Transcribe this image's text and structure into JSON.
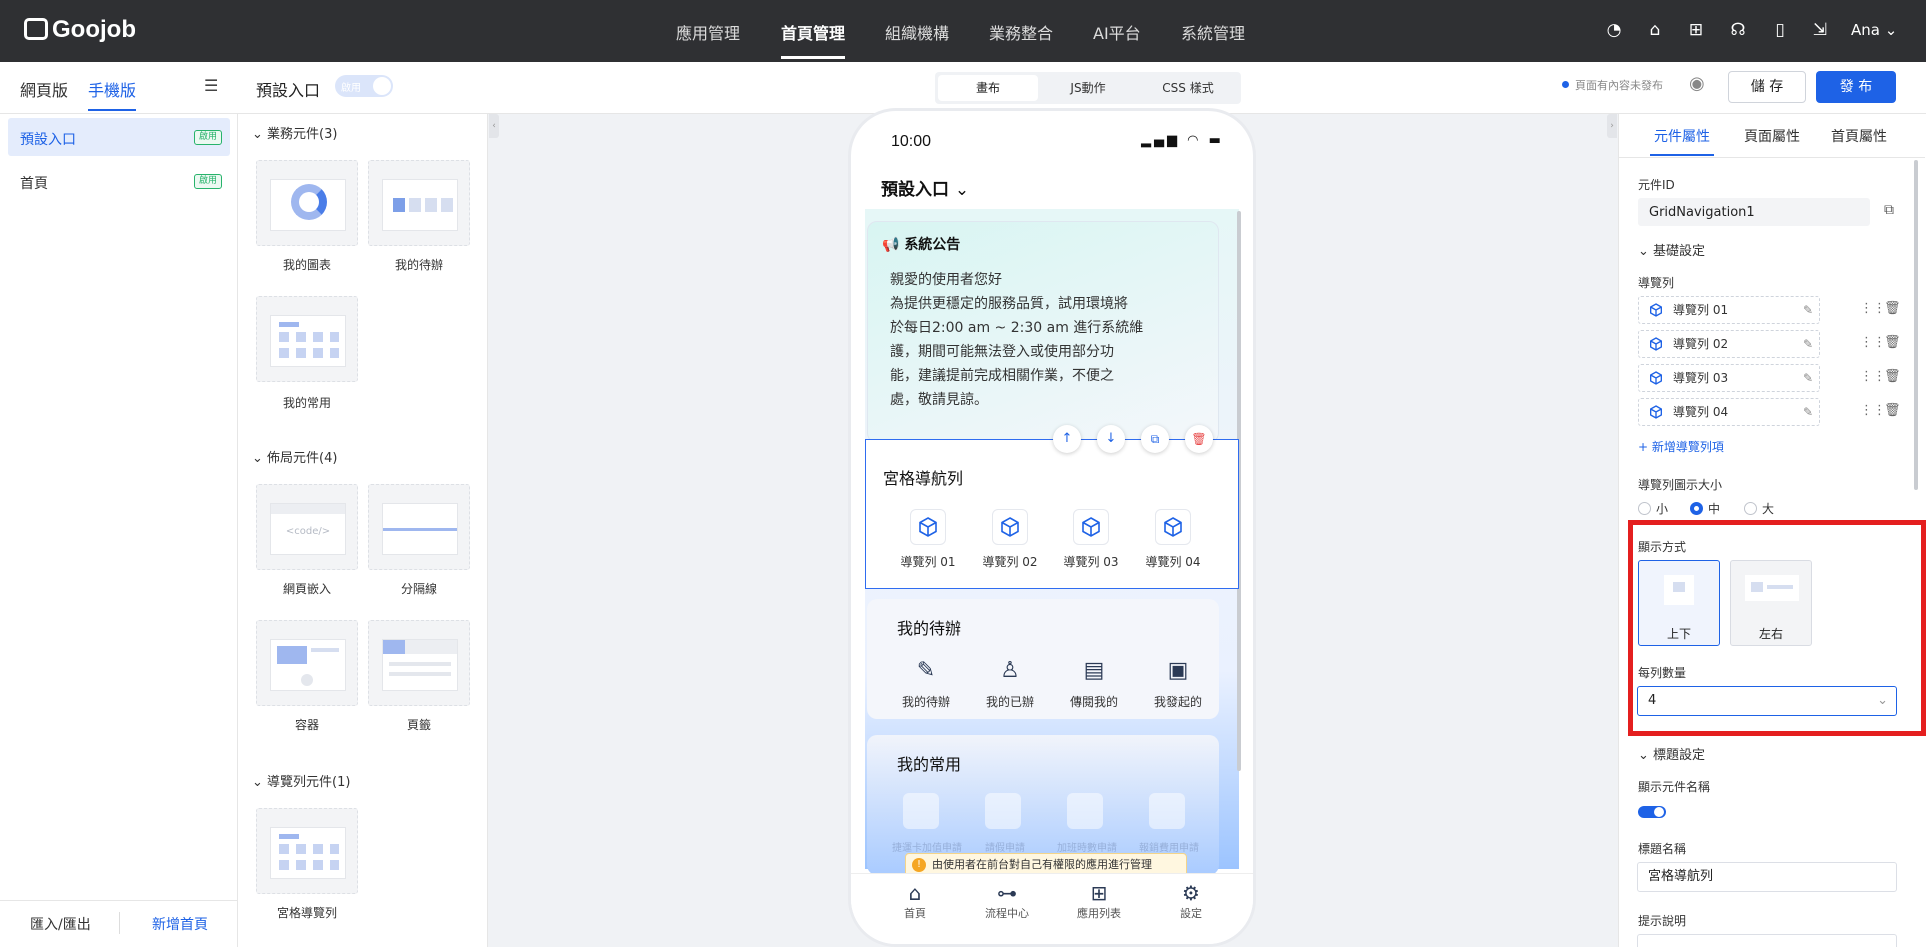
{
  "topbar": {
    "logo": "Goojob",
    "nav": [
      "應用管理",
      "首頁管理",
      "組織機構",
      "業務整合",
      "AI平台",
      "系統管理"
    ],
    "active_index": 1,
    "user": "Ana"
  },
  "secbar": {
    "tab_web": "網頁版",
    "tab_mobile": "手機版",
    "page_title": "預設入口",
    "toggle_label": "啟用",
    "views": [
      "畫布",
      "JS動作",
      "CSS 樣式"
    ],
    "status": "頁面有內容未發布",
    "save": "儲 存",
    "publish": "發 布"
  },
  "leftnav": {
    "items": [
      {
        "label": "預設入口",
        "badge": "啟用"
      },
      {
        "label": "首頁",
        "badge": "啟用"
      }
    ],
    "import_export": "匯入/匯出",
    "add_home": "新增首頁"
  },
  "components": {
    "business_title": "業務元件(3)",
    "business": [
      "我的圖表",
      "我的待辦",
      "我的常用"
    ],
    "layout_title": "佈局元件(4)",
    "layout": [
      "網頁嵌入",
      "分隔線",
      "容器",
      "頁籤"
    ],
    "layout_code": "<code/>",
    "nav_title": "導覽列元件(1)",
    "nav": [
      "宮格導覽列"
    ]
  },
  "phone": {
    "time": "10:00",
    "entry": "預設入口",
    "notice_title": "系統公告",
    "notice_lines": [
      "親愛的使用者您好",
      "為提供更穩定的服務品質，試用環境將",
      "於每日2:00 am ~ 2:30 am 進行系統維",
      "護，期間可能無法登入或使用部分功",
      "能，建議提前完成相關作業，不便之",
      "處，敬請見諒。"
    ],
    "grid_title": "宮格導航列",
    "grid_items": [
      "導覽列 01",
      "導覽列 02",
      "導覽列 03",
      "導覽列 04"
    ],
    "todo_title": "我的待辦",
    "todo_items": [
      "我的待辦",
      "我的已辦",
      "傳閱我的",
      "我發起的"
    ],
    "common_title": "我的常用",
    "common_faded": [
      "捷運卡加值申請",
      "請假申請",
      "加班時數申請",
      "報銷費用申請"
    ],
    "warning": "由使用者在前台對自己有權限的應用進行管理",
    "tabs": [
      "首頁",
      "流程中心",
      "應用列表",
      "設定"
    ]
  },
  "props": {
    "tabs": [
      "元件屬性",
      "頁面屬性",
      "首頁屬性"
    ],
    "id_label": "元件ID",
    "id_value": "GridNavigation1",
    "basic": "基礎設定",
    "navlist_label": "導覽列",
    "navlist": [
      "導覽列 01",
      "導覽列 02",
      "導覽列 03",
      "導覽列 04"
    ],
    "add_nav": "+ 新增導覽列項",
    "icon_size_label": "導覽列圖示大小",
    "sizes": [
      "小",
      "中",
      "大"
    ],
    "size_selected": 1,
    "display_label": "顯示方式",
    "display_opts": [
      "上下",
      "左右"
    ],
    "per_row_label": "每列數量",
    "per_row_value": "4",
    "title_settings": "標題設定",
    "show_name_label": "顯示元件名稱",
    "show_name": true,
    "title_name_label": "標題名稱",
    "title_name_value": "宮格導航列",
    "hint_label": "提示說明"
  },
  "colors": {
    "accent": "#1e62e6",
    "topbar": "#2f3033",
    "highlight": "#e41f1f"
  }
}
